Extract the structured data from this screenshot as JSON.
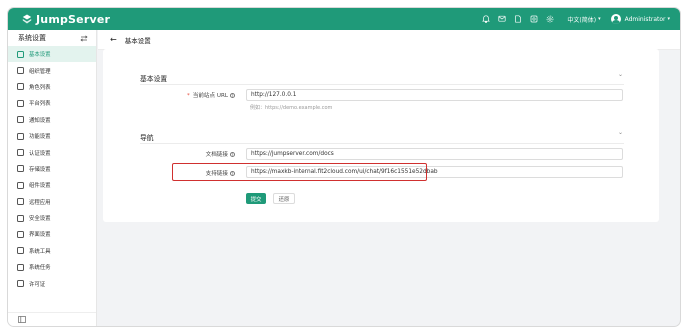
{
  "app": {
    "brand": "JumpServer",
    "language": "中文(简体)",
    "user": "Administrator"
  },
  "topbar_icons": [
    "bell-icon",
    "message-icon",
    "file-icon",
    "help-icon",
    "settings-icon"
  ],
  "sidebar": {
    "title": "系统设置",
    "items": [
      {
        "label": "基本设置",
        "icon": "grid-icon",
        "active": true
      },
      {
        "label": "组织管理",
        "icon": "org-icon"
      },
      {
        "label": "角色列表",
        "icon": "role-icon"
      },
      {
        "label": "平台列表",
        "icon": "platform-icon"
      },
      {
        "label": "通知设置",
        "icon": "bell-icon"
      },
      {
        "label": "功能设置",
        "icon": "feature-icon"
      },
      {
        "label": "认证设置",
        "icon": "auth-icon"
      },
      {
        "label": "存储设置",
        "icon": "storage-icon"
      },
      {
        "label": "组件设置",
        "icon": "component-icon"
      },
      {
        "label": "远程应用",
        "icon": "remote-app-icon"
      },
      {
        "label": "安全设置",
        "icon": "shield-icon"
      },
      {
        "label": "界面设置",
        "icon": "interface-icon"
      },
      {
        "label": "系统工具",
        "icon": "tools-icon"
      },
      {
        "label": "系统任务",
        "icon": "task-icon"
      },
      {
        "label": "许可证",
        "icon": "license-icon"
      }
    ]
  },
  "page": {
    "title": "基本设置"
  },
  "form": {
    "basic": {
      "title": "基本设置",
      "site_url": {
        "label": "当前站点 URL",
        "value": "http://127.0.0.1",
        "hint": "例如：https://demo.example.com"
      }
    },
    "nav": {
      "title": "导航",
      "doc_link": {
        "label": "文档链接",
        "value": "https://jumpserver.com/docs"
      },
      "support_link": {
        "label": "支持链接",
        "value": "https://maxkb-internal.fit2cloud.com/ui/chat/9f16c1551e52dbab"
      }
    },
    "submit_label": "提交",
    "reset_label": "还原"
  },
  "colors": {
    "brand": "#1f9a79",
    "highlight": "#d0302f"
  }
}
